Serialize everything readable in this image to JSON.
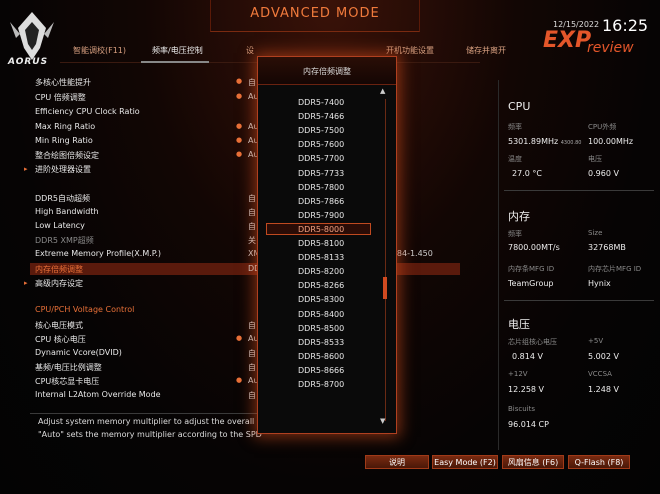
{
  "header": {
    "mode_title": "ADVANCED MODE",
    "logo_text": "AORUS",
    "date": "12/15/2022",
    "time": "16:25",
    "brand_exp": "EXP",
    "brand_review": "review",
    "tabs": [
      {
        "label": "智能调校(F11)"
      },
      {
        "label": "频率/电压控制"
      },
      {
        "label": "设"
      },
      {
        "label": "开机功能设置"
      },
      {
        "label": "储存并离开"
      }
    ]
  },
  "left": {
    "rows": [
      {
        "label": "多核心性能提升",
        "value": "自"
      },
      {
        "label": "CPU 倍频调整",
        "value": "Au"
      },
      {
        "label": "Efficiency CPU Clock Ratio",
        "value": ""
      },
      {
        "label": "Max Ring Ratio",
        "value": "Au"
      },
      {
        "label": "Min Ring Ratio",
        "value": "Au"
      },
      {
        "label": "整合绘图倍频设定",
        "value": "Au"
      },
      {
        "label": "进阶处理器设置",
        "value": ""
      },
      {
        "label": "DDR5自动超频",
        "value": "自"
      },
      {
        "label": "High Bandwidth",
        "value": "自"
      },
      {
        "label": "Low Latency",
        "value": "自"
      },
      {
        "label": "DDR5 XMP超频",
        "value": "关"
      },
      {
        "label": "Extreme Memory Profile(X.M.P.)",
        "value": "XM"
      },
      {
        "label": "内存倍频调整",
        "value": "DD"
      },
      {
        "label": "高级内存设定",
        "value": ""
      }
    ],
    "xmp_tail": "-84-1.450",
    "section_title": "CPU/PCH Voltage Control",
    "volt_rows": [
      {
        "label": "核心电压模式",
        "value": "自"
      },
      {
        "label": "CPU 核心电压",
        "value": "Au"
      },
      {
        "label": "Dynamic Vcore(DVID)",
        "value": "自"
      },
      {
        "label": "基频/电压比例调整",
        "value": "自"
      },
      {
        "label": "CPU核芯显卡电压",
        "value": "Au"
      },
      {
        "label": "Internal L2Atom Override Mode",
        "value": "自"
      }
    ],
    "help_line1": "Adjust system memory multiplier to adjust the overall mem",
    "help_line2": "\"Auto\" sets the memory multiplier according to the SPD"
  },
  "dropdown": {
    "title": "内存倍频调整",
    "options": [
      "DDR5-7400",
      "DDR5-7466",
      "DDR5-7500",
      "DDR5-7600",
      "DDR5-7700",
      "DDR5-7733",
      "DDR5-7800",
      "DDR5-7866",
      "DDR5-7900",
      "DDR5-8000",
      "DDR5-8100",
      "DDR5-8133",
      "DDR5-8200",
      "DDR5-8266",
      "DDR5-8300",
      "DDR5-8400",
      "DDR5-8500",
      "DDR5-8533",
      "DDR5-8600",
      "DDR5-8666",
      "DDR5-8700"
    ],
    "selected": "DDR5-8000"
  },
  "right": {
    "cpu_title": "CPU",
    "freq_label": "频率",
    "ext_label": "CPU外频",
    "freq_value": "5301.89MHz",
    "freq_sub": "4300.80",
    "ext_value": "100.00MHz",
    "temp_label": "温度",
    "volt_label": "电压",
    "temp_value": "27.0 °C",
    "volt_value": "0.960 V",
    "mem_title": "内存",
    "mem_freq_label": "频率",
    "size_label": "Size",
    "mem_freq_value": "7800.00MT/s",
    "size_value": "32768MB",
    "mfg_label": "内存条MFG ID",
    "chip_mfg_label": "内存芯片MFG ID",
    "mfg_value": "TeamGroup",
    "chip_mfg_value": "Hynix",
    "volt_title": "电压",
    "core_volt_label": "芯片组核心电压",
    "p5v_label": "+5V",
    "core_volt_value": "0.814 V",
    "p5v_value": "5.002 V",
    "p12v_label": "+12V",
    "vccsa_label": "VCCSA",
    "p12v_value": "12.258 V",
    "vccsa_value": "1.248 V",
    "biscuits_label": "Biscuits",
    "biscuits_value": "96.014 CP"
  },
  "footer": {
    "help_btn": "说明",
    "easy_btn": "Easy Mode (F2)",
    "fan_btn": "风扇信息 (F6)",
    "qflash_btn": "Q-Flash (F8)"
  },
  "colors": {
    "accent": "#e87038",
    "highlight": "#5a1a0c",
    "border": "#b04020"
  }
}
